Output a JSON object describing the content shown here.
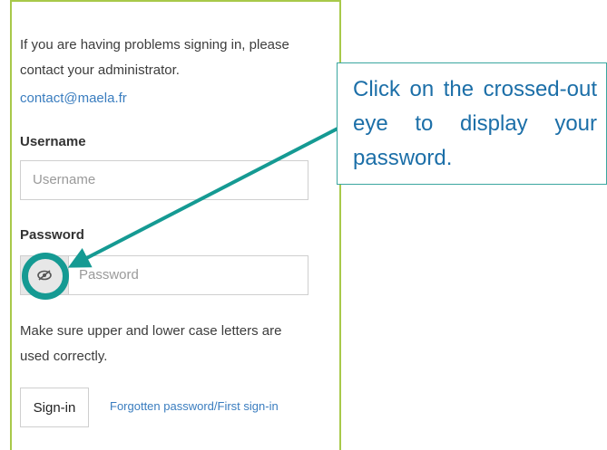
{
  "login": {
    "intro_text": "If you are having problems signing in, please contact your administrator.",
    "contact_email": "contact@maela.fr",
    "username_label": "Username",
    "username_placeholder": "Username",
    "password_label": "Password",
    "password_placeholder": "Password",
    "toggle_icon": "crossed-out-eye-icon",
    "case_hint": "Make sure upper and lower case letters are used correctly.",
    "signin_label": "Sign-in",
    "forgot_link": "Forgotten password/First sign-in"
  },
  "annotation": {
    "callout_text": "Click on the crossed-out eye to display your password.",
    "highlight_color": "#159a93",
    "callout_text_color": "#1c6fa8"
  },
  "colors": {
    "panel_border": "#a8c94a",
    "link": "#3a7dbf"
  }
}
